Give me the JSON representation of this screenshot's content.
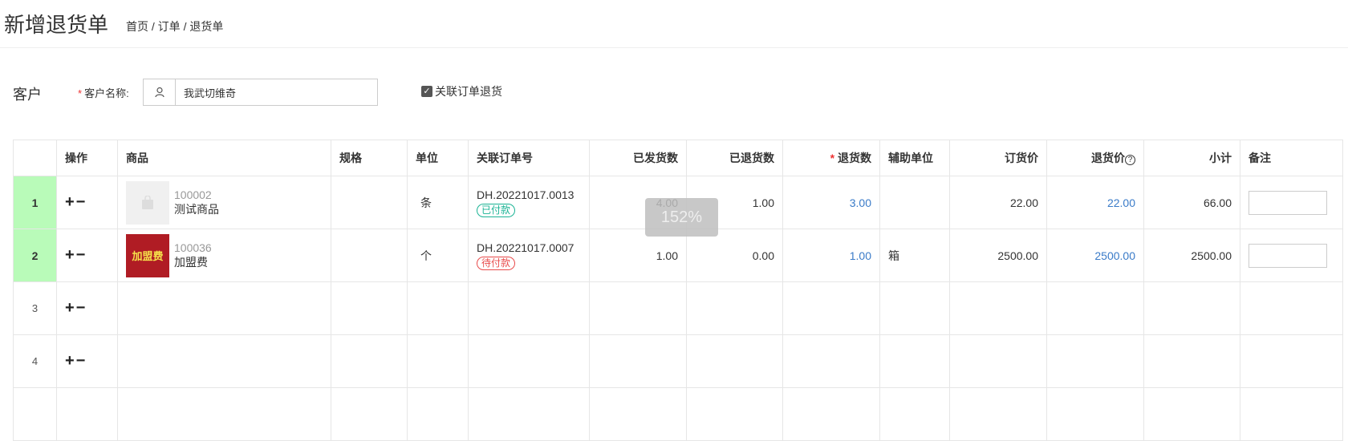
{
  "header": {
    "title": "新增退货单",
    "breadcrumb": "首页 / 订单 / 退货单"
  },
  "customer": {
    "section_label": "客户",
    "field_label": "客户名称:",
    "value": "我武切维奇",
    "link_order_label": "关联订单退货",
    "link_order_checked": true
  },
  "table": {
    "headers": [
      "",
      "操作",
      "商品",
      "规格",
      "单位",
      "关联订单号",
      "已发货数",
      "已退货数",
      "退货数",
      "辅助单位",
      "订货价",
      "退货价",
      "小计",
      "备注"
    ],
    "rows": [
      {
        "num": "1",
        "ops": "+−",
        "code": "100002",
        "name": "测试商品",
        "thumb": "",
        "spec": "",
        "unit": "条",
        "order_no": "DH.20221017.0013",
        "status": "已付款",
        "shipped": "4.00",
        "returned": "1.00",
        "return_qty": "3.00",
        "aux_unit": "",
        "order_price": "22.00",
        "return_price": "22.00",
        "subtotal": "66.00"
      },
      {
        "num": "2",
        "ops": "+−",
        "code": "100036",
        "name": "加盟费",
        "thumb": "加盟费",
        "spec": "",
        "unit": "个",
        "order_no": "DH.20221017.0007",
        "status": "待付款",
        "shipped": "1.00",
        "returned": "0.00",
        "return_qty": "1.00",
        "aux_unit": "箱",
        "order_price": "2500.00",
        "return_price": "2500.00",
        "subtotal": "2500.00"
      },
      {
        "num": "3",
        "ops": "+−"
      },
      {
        "num": "4",
        "ops": "+−"
      }
    ]
  },
  "zoom": "152%",
  "colors": {
    "accent_blue": "#3a7bc8",
    "active_row": "#b9fbb9",
    "paid_green": "#1ab394",
    "unpaid_red": "#e84b4b"
  }
}
